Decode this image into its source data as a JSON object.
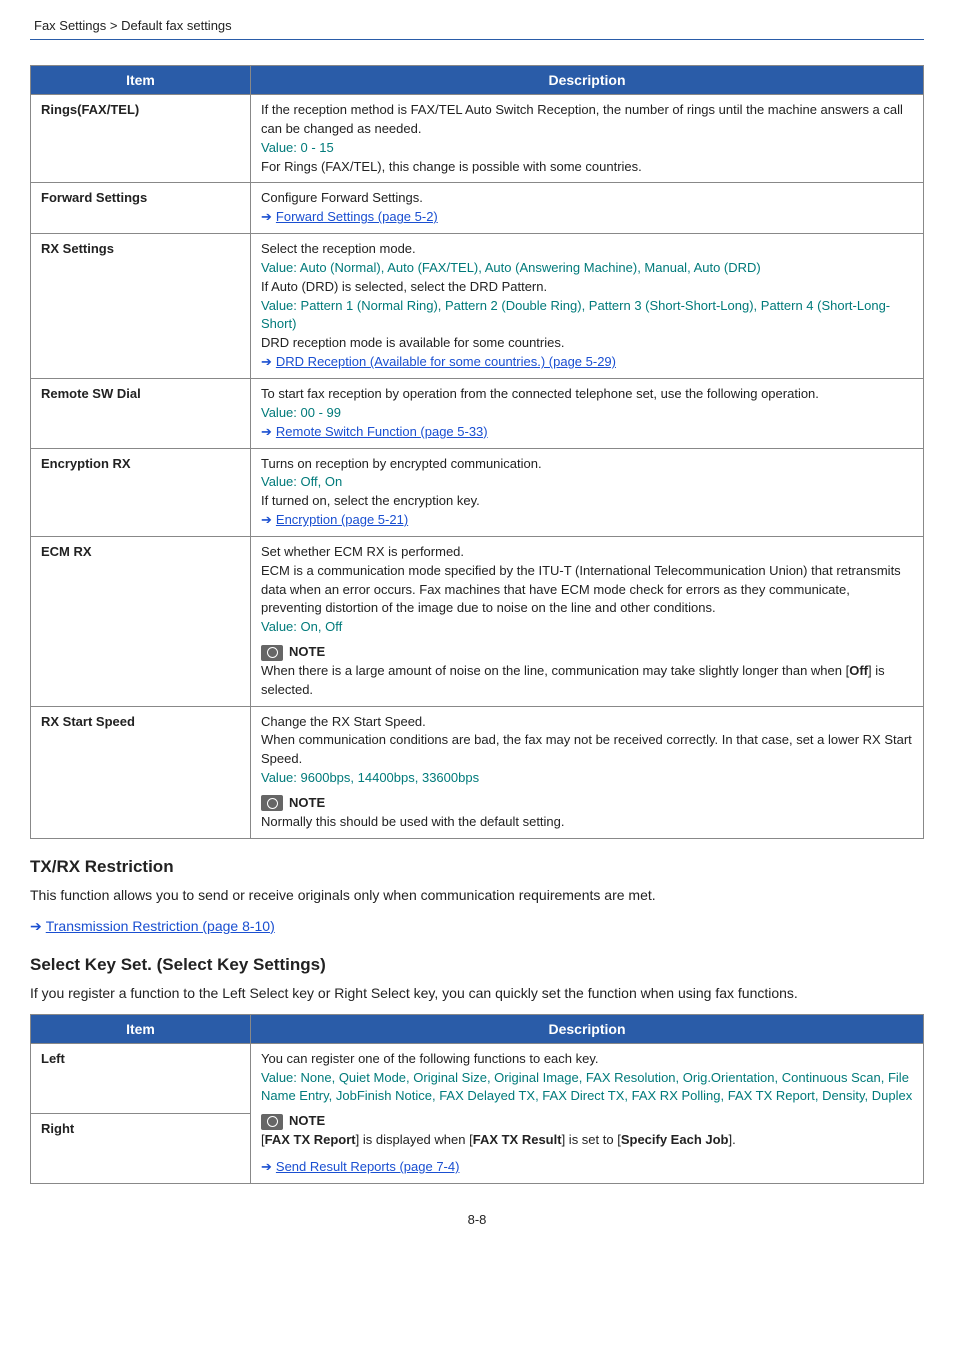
{
  "breadcrumb": {
    "section": "Fax Settings",
    "page": "Default fax settings"
  },
  "table1": {
    "headers": {
      "item": "Item",
      "desc": "Description"
    },
    "rows": {
      "rings": {
        "item": "Rings(FAX/TEL)",
        "l1": "If the reception method is FAX/TEL Auto Switch Reception, the number of rings until the machine answers a call can be changed as needed.",
        "value_label": "Value",
        "value": ": 0 - 15",
        "l3": "For Rings (FAX/TEL), this change is possible with some countries."
      },
      "forward": {
        "item": "Forward Settings",
        "l1": "Configure Forward Settings.",
        "link": "Forward Settings (page 5-2)"
      },
      "rx": {
        "item": "RX Settings",
        "l1": "Select the reception mode.",
        "value_label": "Value",
        "value": ": Auto (Normal), Auto (FAX/TEL), Auto (Answering Machine), Manual, Auto (DRD)",
        "l2": "If Auto (DRD) is selected, select the DRD Pattern.",
        "value2_label": "Value",
        "value2": ": Pattern 1 (Normal Ring), Pattern 2 (Double Ring), Pattern 3 (Short-Short-Long), Pattern 4 (Short-Long-Short)",
        "l3": "DRD reception mode is available for some countries.",
        "link": "DRD Reception (Available for some countries.) (page 5-29)"
      },
      "remote": {
        "item": "Remote SW Dial",
        "l1": "To start fax reception by operation from the connected telephone set, use the following operation.",
        "value_label": "Value",
        "value": ": 00 - 99",
        "link": "Remote Switch Function (page 5-33)"
      },
      "encryption": {
        "item": "Encryption RX",
        "l1": "Turns on reception by encrypted communication.",
        "value_label": "Value",
        "value": ": Off, On",
        "l2": "If turned on, select the encryption key.",
        "link": "Encryption (page 5-21)"
      },
      "ecm": {
        "item": "ECM RX",
        "l1": "Set whether ECM RX is performed.",
        "l2": "ECM is a communication mode specified by the ITU-T (International Telecommunication Union) that retransmits data when an error occurs. Fax machines that have ECM mode check for errors as they communicate, preventing distortion of the image due to noise on the line and other conditions.",
        "value_label": "Value",
        "value": ": On, Off",
        "note_label": "NOTE",
        "note_p1a": "When there is a large amount of noise on the line, communication may take slightly longer than when [",
        "note_off": "Off",
        "note_p1b": "] is selected."
      },
      "rxstart": {
        "item": "RX Start Speed",
        "l1": "Change the RX Start Speed.",
        "l2": "When communication conditions are bad, the fax may not be received correctly. In that case, set a lower RX Start Speed.",
        "value_label": "Value",
        "value": ": 9600bps, 14400bps, 33600bps",
        "note_label": "NOTE",
        "note": "Normally this should be used with the default setting."
      }
    }
  },
  "restriction": {
    "title": "TX/RX Restriction",
    "body": "This function allows you to send or receive originals only when communication requirements are met.",
    "link": "Transmission Restriction (page 8-10)"
  },
  "selectkey": {
    "title": "Select Key Set. (Select Key Settings)",
    "body": "If you register a function to the Left Select key or Right Select key, you can quickly set the function when using fax functions."
  },
  "table2": {
    "headers": {
      "item": "Item",
      "desc": "Description"
    },
    "left_item": "Left",
    "right_item": "Right",
    "shared": {
      "l1": "You can register one of the following functions to each key.",
      "value_label": "Value",
      "value": ": None, Quiet Mode, Original Size, Original Image, FAX Resolution, Orig.Orientation, Continuous Scan, File Name Entry, JobFinish Notice, FAX Delayed TX, FAX Direct TX, FAX RX Polling, FAX TX Report, Density, Duplex",
      "note_label": "NOTE",
      "note_a": "[",
      "note_b1": "FAX TX Report",
      "note_c": "] is displayed when [",
      "note_b2": "FAX TX Result",
      "note_d": "] is set to [",
      "note_b3": "Specify Each Job",
      "note_e": "].",
      "link": "Send Result Reports (page 7-4)"
    }
  },
  "page_num": "8-8"
}
